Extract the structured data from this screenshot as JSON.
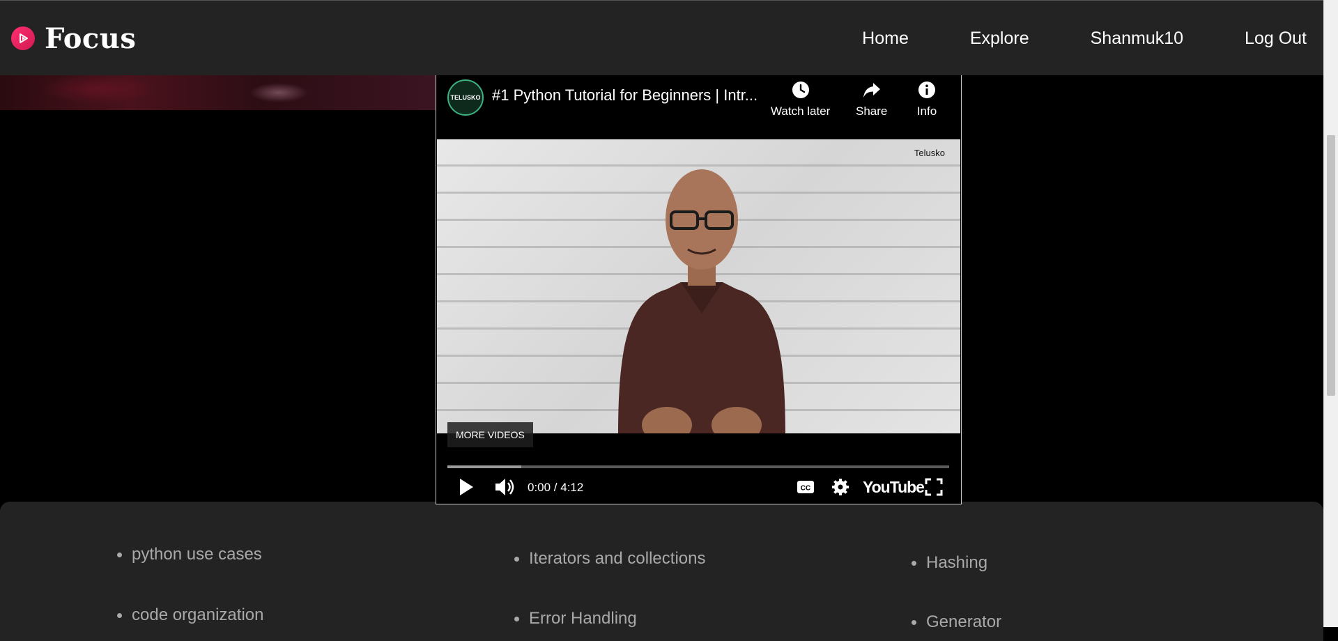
{
  "app": {
    "brand": "Focus"
  },
  "nav": {
    "home": "Home",
    "explore": "Explore",
    "user": "Shanmuk10",
    "logout": "Log Out"
  },
  "player": {
    "channel_badge": "TELUSKO",
    "title": "#1 Python Tutorial for Beginners | Intr...",
    "watch_later": "Watch later",
    "share": "Share",
    "info": "Info",
    "watermark": "Telusko",
    "more_videos": "MORE VIDEOS",
    "time": "0:00 / 4:12",
    "youtube": "YouTube",
    "buffered_fraction": 0.147
  },
  "topics": {
    "col1": [
      "python use cases",
      "code organization"
    ],
    "col2": [
      "Iterators and collections",
      "Error Handling"
    ],
    "col3": [
      "Hashing",
      "Generator"
    ]
  },
  "colors": {
    "navbar_bg": "#232323",
    "brand_accent": "#e8255d",
    "topic_text": "#a9a9a9",
    "page_bg": "#000000"
  }
}
